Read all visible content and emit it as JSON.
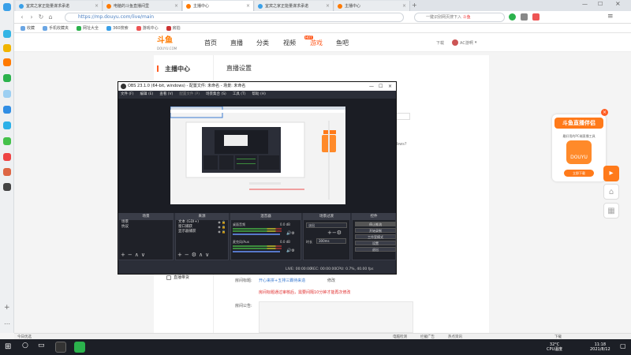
{
  "browser": {
    "tabs": [
      {
        "label": "宜宾之家正能量谋求承诺",
        "active": false
      },
      {
        "label": "电脑的斗鱼直播间里",
        "active": false
      },
      {
        "label": "主播中心",
        "active": true
      },
      {
        "label": "宜宾之家正能量谋求承诺",
        "active": false
      },
      {
        "label": "主播中心",
        "active": false
      }
    ],
    "url": "https://mp.douyu.com/live/main",
    "search_placeholder": "一键识别网页搜下入",
    "search_hot": "斗鱼",
    "bookmarks": [
      "收藏",
      "手机收藏夹",
      "网址大全",
      "360搜索",
      "游戏中心",
      "房拍"
    ]
  },
  "header": {
    "logo": "斗鱼",
    "logo_sub": "DOUYU.COM",
    "nav": [
      "首页",
      "直播",
      "分类",
      "视频",
      "游戏",
      "鱼吧"
    ],
    "nav_badge": "HOT",
    "download": "下载",
    "username": "AC游啊"
  },
  "content": {
    "side_title": "主播中心",
    "page_title": "直播设置",
    "bottom_menu": "直播带货",
    "notice_label": "房间标题:",
    "notice_value": "开心来拼+五排三霸待来造",
    "edit_link": "修改",
    "notice_warn": "房间标题通过审核后，需要间隔10分钟才能再次修改",
    "announce_label": "房间公告:",
    "stream_hint": "bws?"
  },
  "ad": {
    "title": "斗鱼直播伴侣",
    "desc": "最好用的PC端直播工具",
    "pic_label": "DOUYU",
    "button": "立即下载"
  },
  "float_buttons": [
    "play-circle-icon",
    "home-icon",
    "qr-icon"
  ],
  "obs": {
    "title": "OBS 23.1.0 (64-bit, windows) - 配置文件: 未命名 - 场景: 未命名",
    "menu": [
      "文件 (F)",
      "编辑 (E)",
      "查看 (V)",
      "配置文件 (P)",
      "场景集合 (S)",
      "工具 (T)",
      "帮助 (H)"
    ],
    "docks": {
      "scenes": {
        "title": "场景",
        "items": [
          "场景",
          "抗议"
        ]
      },
      "sources": {
        "title": "来源",
        "items": [
          "文本 (GDI+)",
          "窗口捕获",
          "显示器捕获"
        ]
      },
      "mixer": {
        "title": "混音器",
        "items": [
          "桌面音频",
          "麦克风/Aux"
        ],
        "levels": [
          "0.0 dB",
          "0.0 dB"
        ]
      },
      "transitions": {
        "title": "场景过渡",
        "mode": "淡出",
        "duration_label": "时长",
        "duration_value": "300ms"
      },
      "controls": {
        "title": "控件",
        "buttons": [
          "停止推流",
          "开始录制",
          "工作室模式",
          "设置",
          "退出"
        ]
      }
    },
    "status": {
      "live": "LIVE: 00:00:00",
      "rec": "REC: 00:00:00",
      "cpu": "CPU: 0.7%, 40.00 fps"
    }
  },
  "page_statusbar": {
    "left": "今日优选",
    "right_items": [
      "电脑检测",
      "拦截广告",
      "热点资讯",
      "下载"
    ]
  },
  "taskbar": {
    "weather_temp": "32°C",
    "weather_label": "CPU温度",
    "time": "11:18",
    "date": "2021/8/12"
  }
}
